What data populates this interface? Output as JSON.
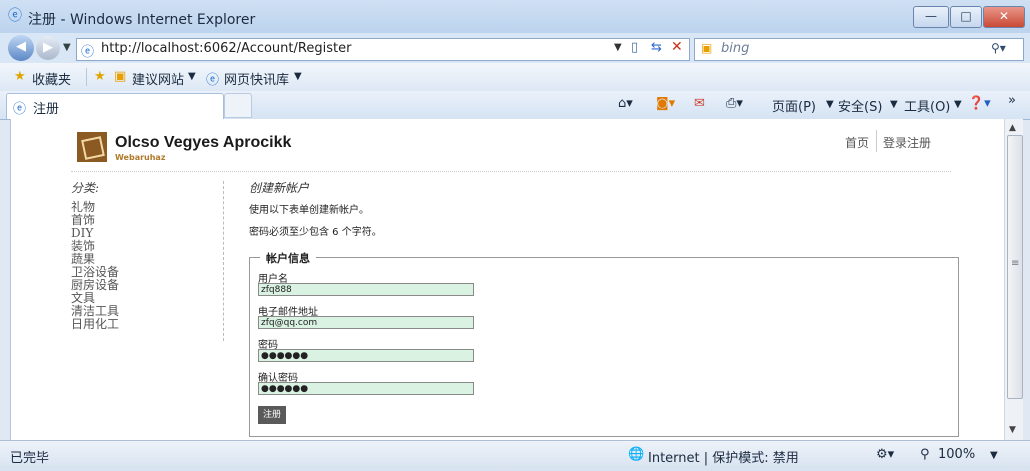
{
  "window": {
    "title": "注册 - Windows Internet Explorer",
    "min": "—",
    "max": "□",
    "close": "✕"
  },
  "address_bar": {
    "url": "http://localhost:6062/Account/Register",
    "search_placeholder": "bing"
  },
  "favorites_bar": {
    "favorites": "收藏夹",
    "suggested_sites": "建议网站",
    "web_slice_gallery": "网页快讯库"
  },
  "tab": {
    "label": "注册"
  },
  "commands": {
    "page": "页面(P)",
    "safety": "安全(S)",
    "tools": "工具(O)"
  },
  "site": {
    "title": "Olcso Vegyes Aprocikk",
    "subtitle": "Webaruhaz",
    "nav": {
      "home": "首页",
      "login_register": "登录注册"
    }
  },
  "sidebar": {
    "title": "分类:",
    "items": [
      "礼物",
      "首饰",
      "DIY",
      "装饰",
      "蔬果",
      "卫浴设备",
      "厨房设备",
      "文具",
      "清洁工具",
      "日用化工"
    ]
  },
  "form": {
    "heading": "创建新帐户",
    "intro": "使用以下表单创建新帐户。",
    "password_hint": "密码必须至少包含 6 个字符。",
    "legend": "帐户信息",
    "username_label": "用户名",
    "username_value": "zfq888",
    "email_label": "电子邮件地址",
    "email_value": "zfq@qq.com",
    "password_label": "密码",
    "password_value": "●●●●●●",
    "confirm_label": "确认密码",
    "confirm_value": "●●●●●●",
    "submit_label": "注册"
  },
  "status_bar": {
    "status": "已完毕",
    "zone": "Internet | 保护模式: 禁用",
    "zoom": "100%"
  }
}
